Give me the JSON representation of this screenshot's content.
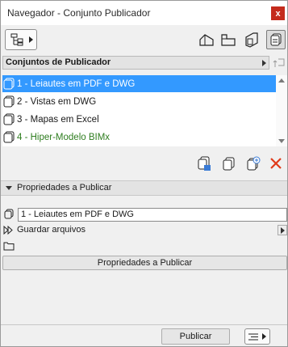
{
  "window": {
    "title": "Navegador - Conjunto Publicador",
    "close_glyph": "x"
  },
  "toolbar": {
    "mode_dropdown_icon": "tree-icon",
    "icons": [
      "project-map-icon",
      "view-map-icon",
      "layout-book-icon",
      "publisher-sets-icon"
    ]
  },
  "sets_header": {
    "label": "Conjuntos de Publicador"
  },
  "sets": [
    {
      "label": "1 - Leiautes em PDF e DWG",
      "selected": true,
      "color": "#ffffff"
    },
    {
      "label": "2 - Vistas em DWG",
      "selected": false,
      "color": "#1a1a1a"
    },
    {
      "label": "3 - Mapas em Excel",
      "selected": false,
      "color": "#1a1a1a"
    },
    {
      "label": "4 - Hiper-Modelo BIMx",
      "selected": false,
      "color": "#2e7d1f"
    }
  ],
  "actions": [
    "new-publisher-set-icon",
    "duplicate-set-icon",
    "add-set-icon",
    "delete-icon"
  ],
  "properties": {
    "header": "Propriedades a Publicar",
    "name_value": "1 - Leiautes em PDF e DWG",
    "save_label": "Guardar arquivos",
    "button_label": "Propriedades a Publicar"
  },
  "footer": {
    "publish_label": "Publicar"
  },
  "colors": {
    "selection": "#3399ff",
    "close": "#c42b1c",
    "delete": "#e03a1a",
    "bimx_green": "#2e7d1f"
  }
}
